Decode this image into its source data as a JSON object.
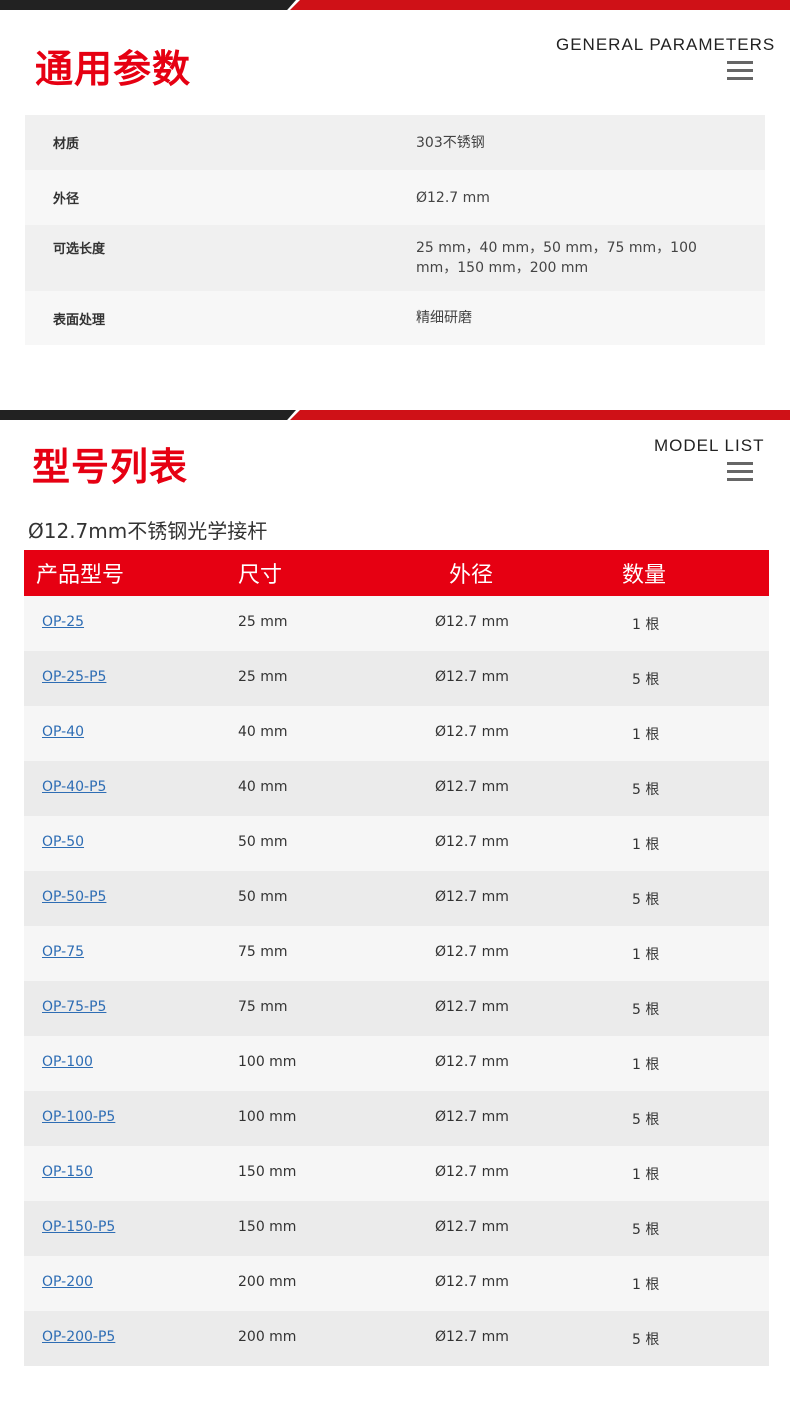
{
  "sections": {
    "general": {
      "title_cn": "通用参数",
      "title_en": "GENERAL PARAMETERS",
      "params": [
        {
          "key": "材质",
          "value": "303不锈钢"
        },
        {
          "key": "外径",
          "value": "Ø12.7 mm"
        },
        {
          "key": "可选长度",
          "value": "25 mm，40 mm，50 mm，75 mm，100 mm，150 mm，200 mm"
        },
        {
          "key": "表面处理",
          "value": "精细研磨"
        }
      ]
    },
    "models": {
      "title_cn": "型号列表",
      "title_en": "MODEL LIST",
      "subtitle": "Ø12.7mm不锈钢光学接杆",
      "headers": [
        "产品型号",
        "尺寸",
        "外径",
        "数量"
      ],
      "rows": [
        {
          "model": "OP-25",
          "size": "25 mm",
          "dia": "Ø12.7 mm",
          "qty": "1 根"
        },
        {
          "model": "OP-25-P5",
          "size": "25 mm",
          "dia": "Ø12.7 mm",
          "qty": "5 根"
        },
        {
          "model": "OP-40",
          "size": "40 mm",
          "dia": "Ø12.7 mm",
          "qty": "1 根"
        },
        {
          "model": "OP-40-P5",
          "size": "40 mm",
          "dia": "Ø12.7 mm",
          "qty": "5 根"
        },
        {
          "model": "OP-50",
          "size": "50 mm",
          "dia": "Ø12.7 mm",
          "qty": "1 根"
        },
        {
          "model": "OP-50-P5",
          "size": "50 mm",
          "dia": "Ø12.7 mm",
          "qty": "5 根"
        },
        {
          "model": "OP-75",
          "size": "75 mm",
          "dia": "Ø12.7 mm",
          "qty": "1 根"
        },
        {
          "model": "OP-75-P5",
          "size": "75 mm",
          "dia": "Ø12.7 mm",
          "qty": "5 根"
        },
        {
          "model": "OP-100",
          "size": "100 mm",
          "dia": "Ø12.7 mm",
          "qty": "1 根"
        },
        {
          "model": "OP-100-P5",
          "size": "100 mm",
          "dia": "Ø12.7 mm",
          "qty": "5 根"
        },
        {
          "model": "OP-150",
          "size": "150 mm",
          "dia": "Ø12.7 mm",
          "qty": "1 根"
        },
        {
          "model": "OP-150-P5",
          "size": "150 mm",
          "dia": "Ø12.7 mm",
          "qty": "5 根"
        },
        {
          "model": "OP-200",
          "size": "200 mm",
          "dia": "Ø12.7 mm",
          "qty": "1 根"
        },
        {
          "model": "OP-200-P5",
          "size": "200 mm",
          "dia": "Ø12.7 mm",
          "qty": "5 根"
        }
      ]
    }
  },
  "icons": {
    "menu": "hamburger-menu-icon"
  },
  "colors": {
    "accent": "#e60012",
    "link": "#2e6db4",
    "dark_bar": "#222222"
  }
}
